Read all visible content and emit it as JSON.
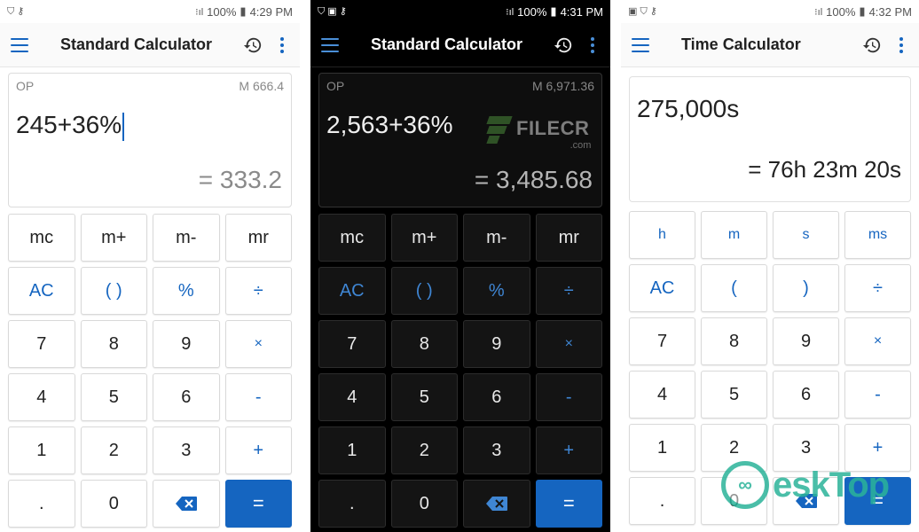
{
  "screens": [
    {
      "theme": "light",
      "status": {
        "left": "⛉ ⚷",
        "signal": "⁝ıl",
        "battery": "100%",
        "time": "4:29 PM"
      },
      "title": "Standard Calculator",
      "display": {
        "op": "OP",
        "memory": "M 666.4",
        "expression": "245+36%",
        "result": "= 333.2"
      },
      "keys": [
        [
          "mc",
          "m+",
          "m-",
          "mr"
        ],
        [
          "AC",
          "( )",
          "%",
          "÷"
        ],
        [
          "7",
          "8",
          "9",
          "×"
        ],
        [
          "4",
          "5",
          "6",
          "-"
        ],
        [
          "1",
          "2",
          "3",
          "+"
        ],
        [
          ".",
          "0",
          "⌫",
          "="
        ]
      ]
    },
    {
      "theme": "dark",
      "status": {
        "left": "⛉ ▣ ⚷",
        "signal": "⁝ıl",
        "battery": "100%",
        "time": "4:31 PM"
      },
      "title": "Standard Calculator",
      "display": {
        "op": "OP",
        "memory": "M 6,971.36",
        "expression": "2,563+36%",
        "result": "= 3,485.68"
      },
      "watermark": {
        "text": "FILECR",
        "sub": ".com"
      },
      "keys": [
        [
          "mc",
          "m+",
          "m-",
          "mr"
        ],
        [
          "AC",
          "( )",
          "%",
          "÷"
        ],
        [
          "7",
          "8",
          "9",
          "×"
        ],
        [
          "4",
          "5",
          "6",
          "-"
        ],
        [
          "1",
          "2",
          "3",
          "+"
        ],
        [
          ".",
          "0",
          "⌫",
          "="
        ]
      ]
    },
    {
      "theme": "light",
      "status": {
        "left": "▣ ⛉ ⚷",
        "signal": "⁝ıl",
        "battery": "100%",
        "time": "4:32 PM"
      },
      "title": "Time Calculator",
      "display": {
        "expression": "275,000s",
        "result": "= 76h 23m 20s"
      },
      "keys": [
        [
          "h",
          "m",
          "s",
          "ms"
        ],
        [
          "AC",
          "(",
          ")",
          "÷"
        ],
        [
          "7",
          "8",
          "9",
          "×"
        ],
        [
          "4",
          "5",
          "6",
          "-"
        ],
        [
          "1",
          "2",
          "3",
          "+"
        ],
        [
          ".",
          "0",
          "⌫",
          "="
        ]
      ]
    }
  ],
  "overlay_logo": {
    "mark": "∞",
    "text": "eskTop"
  },
  "colors": {
    "accent": "#1565c0",
    "dark_bg": "#000000",
    "light_bg": "#ffffff",
    "logo": "#2bb39a"
  }
}
